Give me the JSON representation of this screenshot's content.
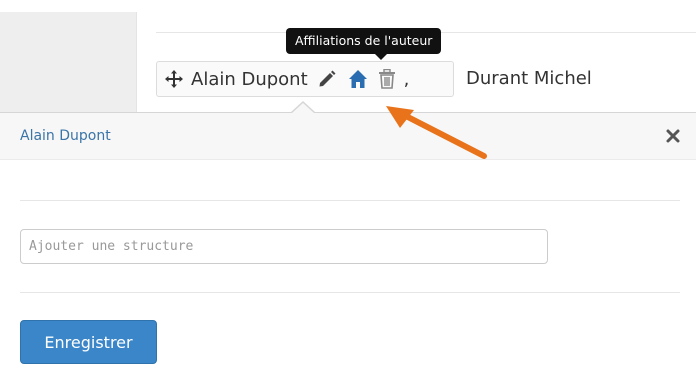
{
  "tooltip": {
    "text": "Affiliations de l'auteur"
  },
  "author_list": {
    "first_author": "Alain Dupont",
    "separator": ",",
    "second_author": "Durant Michel",
    "icons": [
      "move-icon",
      "pencil-icon",
      "home-icon",
      "trash-icon"
    ]
  },
  "popover": {
    "title": "Alain Dupont",
    "close_icon": "close-icon",
    "structure_input": {
      "value": "",
      "placeholder": "Ajouter une structure"
    },
    "save_label": "Enregistrer"
  },
  "colors": {
    "link_blue": "#3a74a8",
    "home_icon": "#2a6db0",
    "button_blue": "#3a86c8",
    "annotation_arrow": "#e8731a",
    "tooltip_bg": "#111111"
  }
}
